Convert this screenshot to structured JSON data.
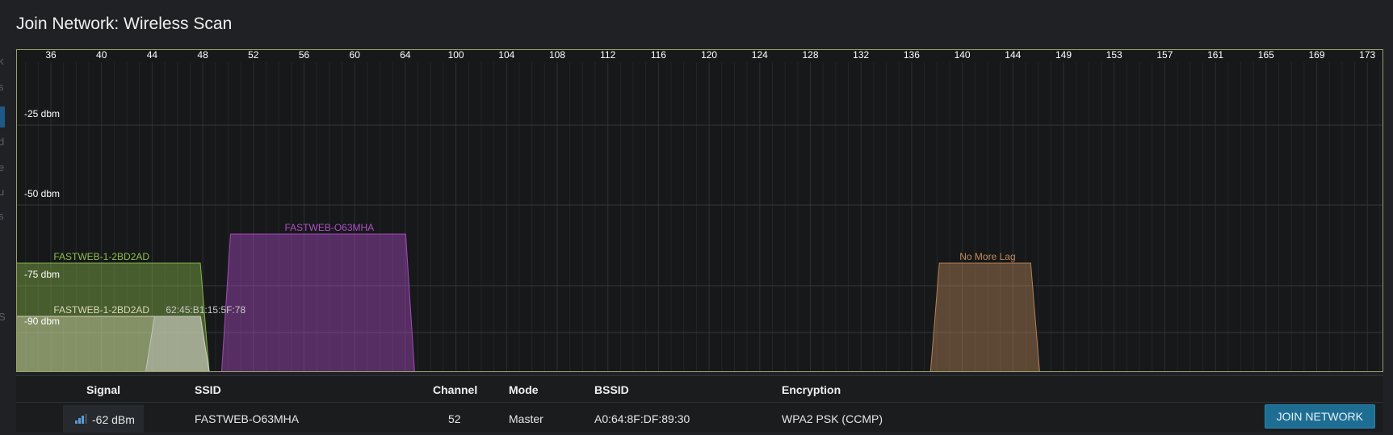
{
  "page": {
    "title": "Join Network: Wireless Scan"
  },
  "chart_data": {
    "type": "area",
    "channels": [
      "36",
      "40",
      "44",
      "48",
      "52",
      "56",
      "60",
      "64",
      "100",
      "104",
      "108",
      "112",
      "116",
      "120",
      "124",
      "128",
      "132",
      "136",
      "140",
      "144",
      "149",
      "153",
      "157",
      "161",
      "165",
      "169",
      "173"
    ],
    "y_labels": [
      "-25 dbm",
      "-50 dbm",
      "-75 dbm",
      "-90 dbm"
    ],
    "networks": [
      {
        "label": "FASTWEB-1-2BD2AD",
        "center": 40,
        "width_mhz": 80,
        "dbm": -73,
        "color": "#8fbf4a"
      },
      {
        "label": "FASTWEB-O63MHA",
        "center": 58,
        "width_mhz": 80,
        "dbm": -64,
        "color": "#b04fc7"
      },
      {
        "label": "FASTWEB-1-2BD2AD",
        "center": 40,
        "width_mhz": 80,
        "dbm": -90,
        "color": "#d8d8b8"
      },
      {
        "label": "62:45:B1:15:5F:78",
        "center": 46,
        "width_mhz": 20,
        "dbm": -90,
        "color": "#c8c8c8"
      },
      {
        "label": "No More Lag",
        "center": 142,
        "width_mhz": 40,
        "dbm": -73,
        "color": "#c28a5a"
      }
    ],
    "grid": true
  },
  "table": {
    "headers": {
      "signal": "Signal",
      "ssid": "SSID",
      "channel": "Channel",
      "mode": "Mode",
      "bssid": "BSSID",
      "encryption": "Encryption"
    },
    "rows": [
      {
        "signal": "-62 dBm",
        "ssid": "FASTWEB-O63MHA",
        "channel": "52",
        "mode": "Master",
        "bssid": "A0:64:8F:DF:89:30",
        "encryption": "WPA2 PSK (CCMP)",
        "action": "JOIN NETWORK"
      }
    ]
  },
  "sidebar_ghost": [
    "k",
    "s",
    "d",
    "e",
    "u",
    "s",
    "S"
  ]
}
